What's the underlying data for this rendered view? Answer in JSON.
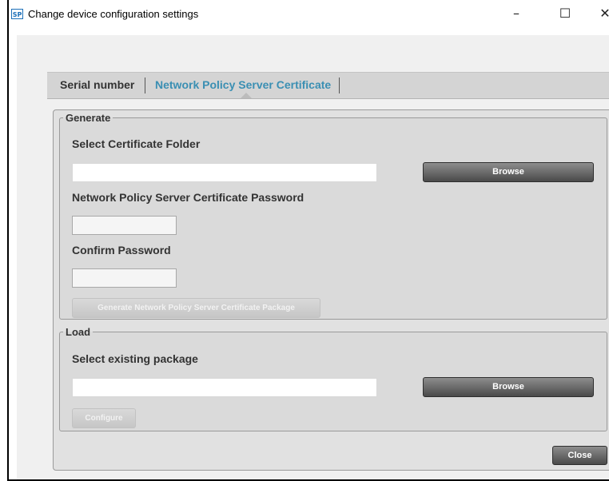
{
  "window": {
    "app_icon_text": "SP",
    "title": "Change device configuration settings",
    "minimize": "–",
    "maximize": "☐",
    "close": "✕"
  },
  "tabs": [
    {
      "label": "Serial number",
      "selected": false
    },
    {
      "label": "Network Policy Server Certificate",
      "selected": true
    }
  ],
  "generate": {
    "legend": "Generate",
    "folder_label": "Select Certificate Folder",
    "folder_value": "",
    "browse_label": "Browse",
    "password_label": "Network Policy Server Certificate Password",
    "password_value": "",
    "confirm_label": "Confirm Password",
    "confirm_value": "",
    "generate_button_label": "Generate Network Policy Server Certificate Package"
  },
  "load": {
    "legend": "Load",
    "package_label": "Select existing package",
    "package_value": "",
    "browse_label": "Browse",
    "configure_label": "Configure"
  },
  "footer": {
    "close_label": "Close"
  },
  "colors": {
    "selected_tab": "#3a8fb3",
    "button_dark": "#4a4a4a",
    "panel_bg": "#e1e1e1"
  }
}
